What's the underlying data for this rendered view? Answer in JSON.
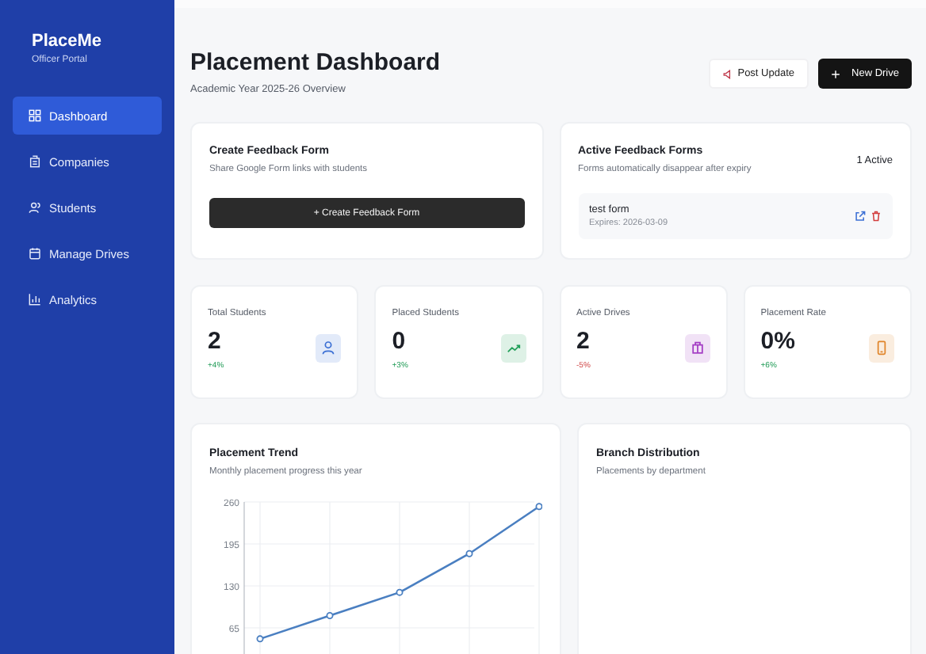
{
  "sidebar": {
    "brand": "PlaceMe",
    "subtitle": "Officer Portal",
    "items": [
      {
        "label": "Dashboard",
        "selected": true
      },
      {
        "label": "Companies",
        "selected": false
      },
      {
        "label": "Students",
        "selected": false
      },
      {
        "label": "Manage Drives",
        "selected": false
      },
      {
        "label": "Analytics",
        "selected": false
      }
    ]
  },
  "header": {
    "title": "Placement Dashboard",
    "subtitle": "Academic Year 2025-26 Overview",
    "buttons": [
      {
        "label": "Post Update",
        "kind": "outline"
      },
      {
        "label": "New Drive",
        "kind": "dark"
      }
    ]
  },
  "create_form": {
    "title": "Create Feedback Form",
    "subtitle": "Share Google Form links with students",
    "button": "+ Create Feedback Form"
  },
  "active_forms": {
    "title": "Active Feedback Forms",
    "subtitle": "Forms automatically disappear after expiry",
    "count": "1 Active",
    "forms": [
      {
        "name": "test form",
        "expiry": "Expires: 2026-03-09"
      }
    ]
  },
  "stats": [
    {
      "label": "Total Students",
      "value": "2",
      "delta": "+4%",
      "kind": "gain",
      "color": "#3b6fd4"
    },
    {
      "label": "Placed Students",
      "value": "0",
      "delta": "+3%",
      "kind": "gain",
      "color": "#22a05a"
    },
    {
      "label": "Active Drives",
      "value": "2",
      "delta": "-5%",
      "kind": "loss",
      "color": "#a33bc4"
    },
    {
      "label": "Placement Rate",
      "value": "0%",
      "delta": "+6%",
      "kind": "gain",
      "color": "#e0852a"
    }
  ],
  "trend_chart": {
    "title": "Placement Trend",
    "subtitle": "Monthly placement progress this year",
    "chart_data": {
      "type": "line",
      "grid": true,
      "ylim": [
        0,
        260
      ],
      "yticks": [
        65,
        130,
        195,
        260
      ],
      "series": [
        {
          "color": "#4a7fc1",
          "marker": true,
          "values": [
            48,
            84,
            120,
            180,
            253
          ]
        }
      ]
    }
  },
  "branch_chart": {
    "title": "Branch Distribution",
    "subtitle": "Placements by department"
  }
}
